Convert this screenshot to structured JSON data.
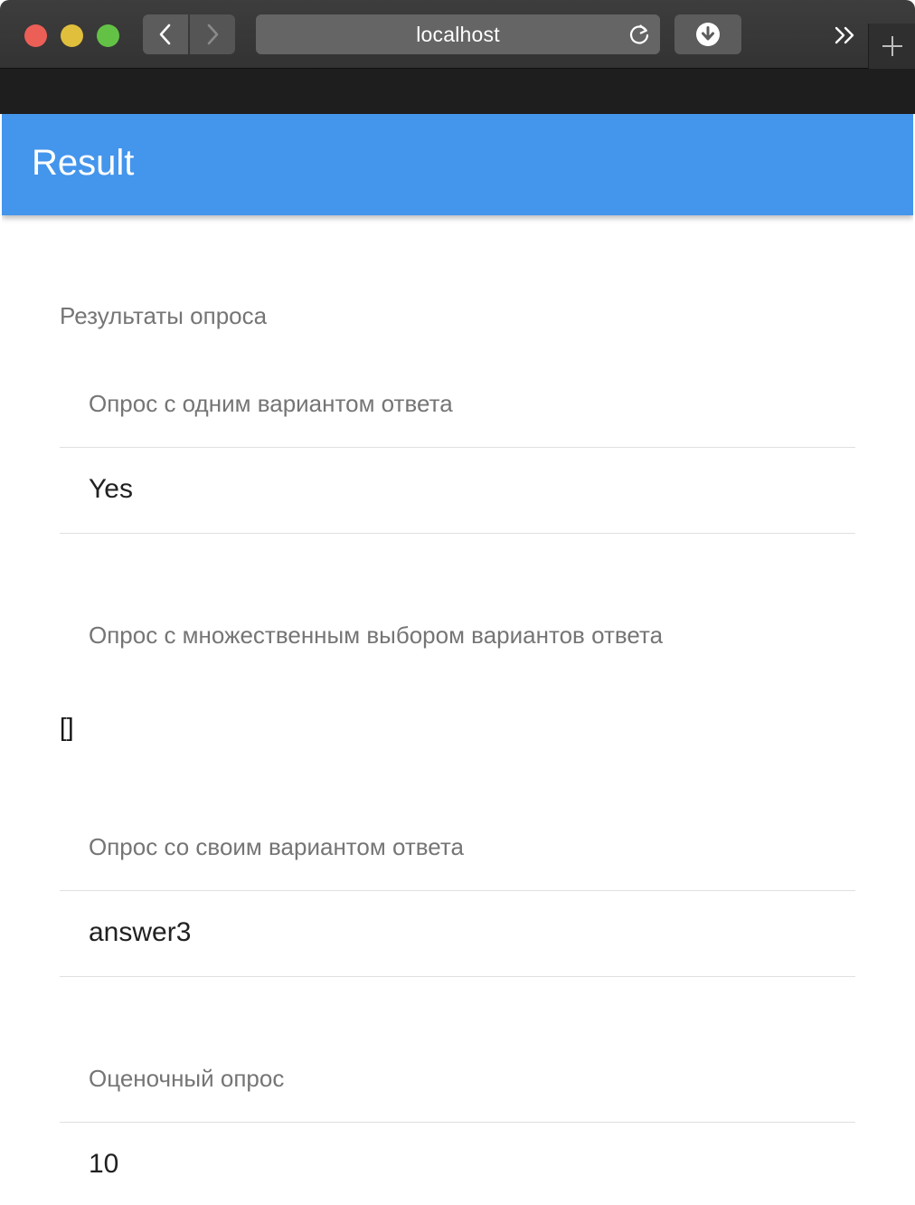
{
  "browser": {
    "url": "localhost"
  },
  "app": {
    "title": "Result"
  },
  "results": {
    "heading": "Результаты опроса",
    "single_choice": {
      "label": "Опрос с одним вариантом ответа",
      "answer": "Yes"
    },
    "multiple_choice": {
      "label": "Опрос с множественным выбором вариантов ответа",
      "answer": "[]"
    },
    "custom_answer": {
      "label": "Опрос со своим вариантом ответа",
      "answer": "answer3"
    },
    "rating": {
      "label": "Оценочный опрос",
      "answer": "10"
    }
  },
  "colors": {
    "header_bg": "#4495ec",
    "label_text": "#757575",
    "answer_text": "#212121"
  }
}
